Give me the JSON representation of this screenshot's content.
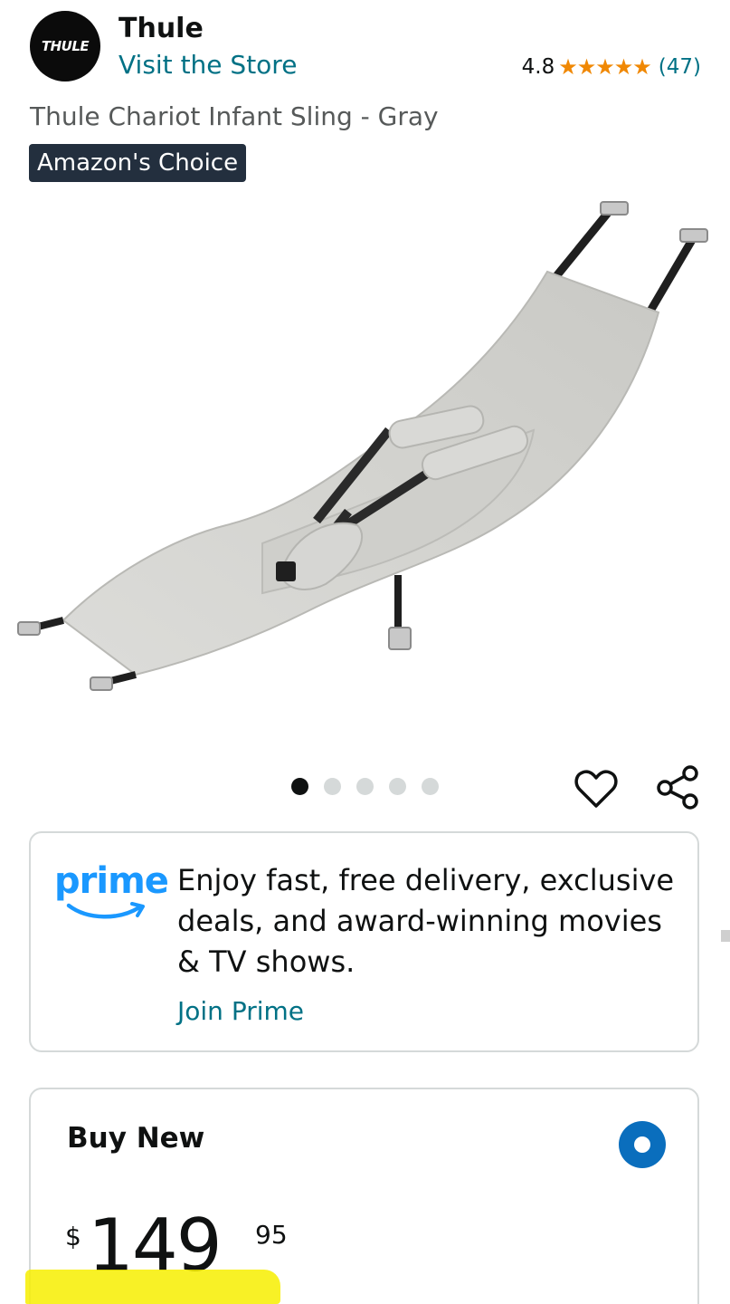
{
  "brand": {
    "logo_text": "THULE",
    "name": "Thule",
    "visit_store": "Visit the Store"
  },
  "rating": {
    "value": "4.8",
    "stars": "★★★★★",
    "count": "(47)",
    "star_color": "#f08804"
  },
  "product": {
    "title": "Thule Chariot Infant Sling - Gray",
    "badge": "Amazon's Choice"
  },
  "carousel": {
    "total": 5,
    "active_index": 0
  },
  "prime": {
    "logo_word": "prime",
    "message": "Enjoy fast, free delivery, exclusive deals, and award-winning movies & TV shows.",
    "cta": "Join Prime",
    "brand_color": "#1a98ff"
  },
  "buy": {
    "label": "Buy New",
    "price_symbol": "$",
    "price_whole": "149",
    "price_fraction": "95",
    "selected": true
  },
  "colors": {
    "link": "#007185",
    "badge_bg": "#232f3e",
    "radio": "#0a6ebd",
    "highlight": "#f7ee00"
  }
}
